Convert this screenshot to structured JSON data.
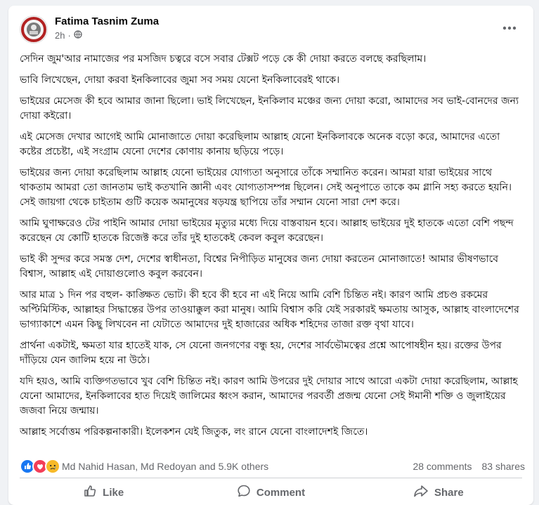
{
  "post": {
    "author": "Fatima Tasnim Zuma",
    "time": "2h",
    "privacy_icon": "globe-icon",
    "paragraphs": [
      "সেদিন জুম'আর নামাজের পর মসজিদ চত্বরে বসে সবার টেক্সট পড়ে কে কী দোয়া করতে বলছে করছিলাম।",
      "ভাবি লিখেছেন, দোয়া করবা ইনকিলাবের জুমা সব সময় যেনো ইনকিলাবেরই থাকে।",
      "ভাইয়ের মেসেজ কী হবে আমার জানা ছিলো। ভাই লিখেছেন, ইনকিলাব মঞ্চের জন্য দোয়া করো, আমাদের সব ভাই-বোনদের জন্য দোয়া কইরো।",
      "এই মেসেজ দেখার আগেই আমি মোনাজাতে দোয়া করেছিলাম আল্লাহ যেনো ইনকিলাবকে অনেক বড়ো করে, আমাদের এতো কষ্টের প্রচেষ্টা, এই সংগ্রাম যেনো দেশের কোণায় কানায় ছড়িয়ে পড়ে।",
      "ভাইয়ের জন্য দোয়া করেছিলাম আল্লাহ যেনো ভাইয়ের যোগ্যতা অনুসারে তাঁকে সম্মানিত করেন। আমরা যারা ভাইয়ের সাথে থাকতাম আমরা তো জানতাম ভাই কতখানি জ্ঞানী এবং যোগ্যতাসম্পন্ন ছিলেন। সেই অনুপাতে তাকে কম গ্লানি সহ্য করতে হয়নি। সেই জায়গা থেকে চাইতাম গুটি কয়েক অমানুষের ষড়যন্ত্র ছাপিয়ে তাঁর সম্মান যেনো সারা দেশ করে।",
      "আমি ঘুণাক্ষরেও টের পাইনি আমার দোয়া ভাইয়ের মৃত্যুর মধ্যে দিয়ে বাস্তবায়ন হবে। আল্লাহ ভাইয়ের দুই হাতকে এতো বেশি পছন্দ করেছেন যে কোটি হাতকে রিজেক্ট করে তাঁর দুই হাতকেই কেবল কবুল করেছেন।",
      "ভাই কী সুন্দর করে সমস্ত দেশ, দেশের স্বাধীনতা, বিশ্বের নিপীড়িত মানুষের জন্য দোয়া করতেন মোনাজাতে! আমার ভীষণভাবে বিশ্বাস, আল্লাহ এই দোয়াগুলোও কবুল করবেন।",
      "আর মাত্র ১ দিন পর বহুল- কাঙ্ক্ষিত ভোট। কী হবে কী হবে না এই নিয়ে আমি বেশি চিন্তিত নই। কারণ আমি প্রচণ্ড রকমের অপ্টিমিস্টিক, আল্লাহর সিদ্ধান্তের উপর তাওয়াক্কুল করা মানুষ। আমি বিশ্বাস করি যেই সরকারই ক্ষমতায় আসুক, আল্লাহ বাংলাদেশের ভাগ্যাকাশে এমন কিছু লিখবেন না যেটাতে আমাদের দুই হাজারের অধিক শহিদের তাজা রক্ত বৃথা যাবে।",
      "প্রার্থনা একটাই, ক্ষমতা যার হাতেই যাক, সে যেনো জনগণের বন্ধু হয়, দেশের সার্বভৌমত্বের প্রশ্নে আপোষহীন হয়। রক্তের উপর দাঁড়িয়ে যেন জালিম হয়ে না উঠে।",
      "যদি হয়ও, আমি ব্যক্তিগতভাবে খুব বেশি চিন্তিত নই। কারণ আমি উপরের দুই দোয়ার সাথে আরো একটা দোয়া করেছিলাম, আল্লাহ যেনো আমাদের, ইনকিলাবের হাত দিয়েই জালিমের ধ্বংস করান, আমাদের পরবর্তী প্রজন্ম যেনো সেই ঈমানী শক্তি ও জুলাইয়ের জজবা নিয়ে জন্মায়।",
      "আল্লাহ সর্বোত্তম পরিকল্পনাকারী। ইলেকশন যেই জিতুক, লং রানে যেনো বাংলাদেশই জিতে।"
    ]
  },
  "engagement": {
    "reaction_icons": [
      "like-reaction-icon",
      "love-reaction-icon",
      "sad-reaction-icon"
    ],
    "reactors": "Md Nahid Hasan, Md Redoyan and 5.9K others",
    "comments": "28 comments",
    "shares": "83 shares"
  },
  "actions": {
    "like": "Like",
    "comment": "Comment",
    "share": "Share"
  },
  "colors": {
    "like_blue": "#1877f2",
    "love_red": "#f33e58",
    "sad_yellow": "#f7b928",
    "secondary_text": "#65676b"
  }
}
